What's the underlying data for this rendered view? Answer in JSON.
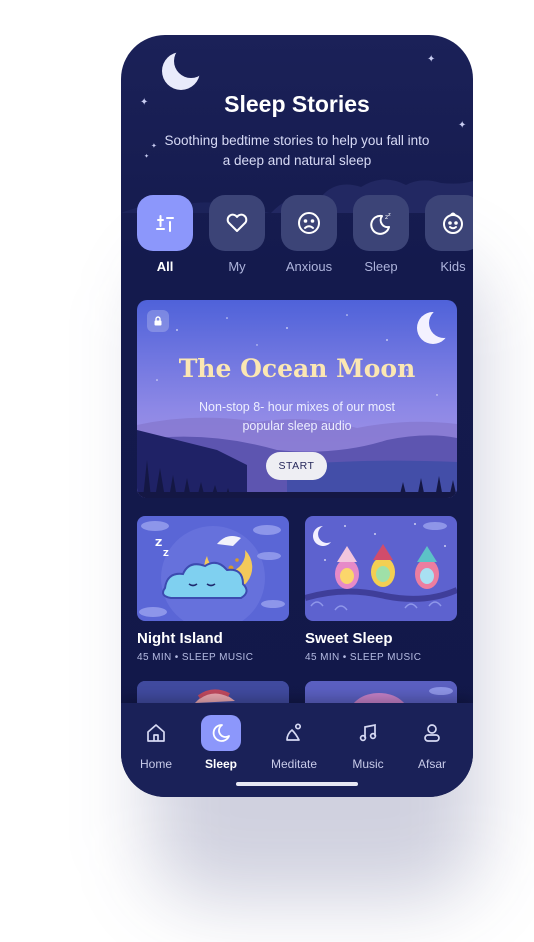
{
  "header": {
    "title": "Sleep Stories",
    "subtitle": "Soothing bedtime stories to help you fall into a deep and natural sleep"
  },
  "categories": [
    {
      "label": "All",
      "icon": "grid-icon",
      "active": true
    },
    {
      "label": "My",
      "icon": "heart-icon",
      "active": false
    },
    {
      "label": "Anxious",
      "icon": "sad-face-icon",
      "active": false
    },
    {
      "label": "Sleep",
      "icon": "moon-zzz-icon",
      "active": false
    },
    {
      "label": "Kids",
      "icon": "baby-face-icon",
      "active": false
    }
  ],
  "featured": {
    "title": "The Ocean Moon",
    "subtitle": "Non-stop 8- hour mixes of our most popular sleep audio",
    "button": "START",
    "locked": true
  },
  "cards": [
    {
      "name": "Night Island",
      "meta": "45 MIN • SLEEP MUSIC"
    },
    {
      "name": "Sweet Sleep",
      "meta": "45 MIN • SLEEP MUSIC"
    }
  ],
  "nav": [
    {
      "label": "Home",
      "icon": "home-icon",
      "active": false
    },
    {
      "label": "Sleep",
      "icon": "moon-icon",
      "active": true
    },
    {
      "label": "Meditate",
      "icon": "meditate-icon",
      "active": false
    },
    {
      "label": "Music",
      "icon": "music-note-icon",
      "active": false
    },
    {
      "label": "Afsar",
      "icon": "user-icon",
      "active": false
    }
  ],
  "colors": {
    "background": "#141a4d",
    "accent": "#8c97fb",
    "tile": "#3c4477",
    "featured_title": "#fbe7b3"
  }
}
